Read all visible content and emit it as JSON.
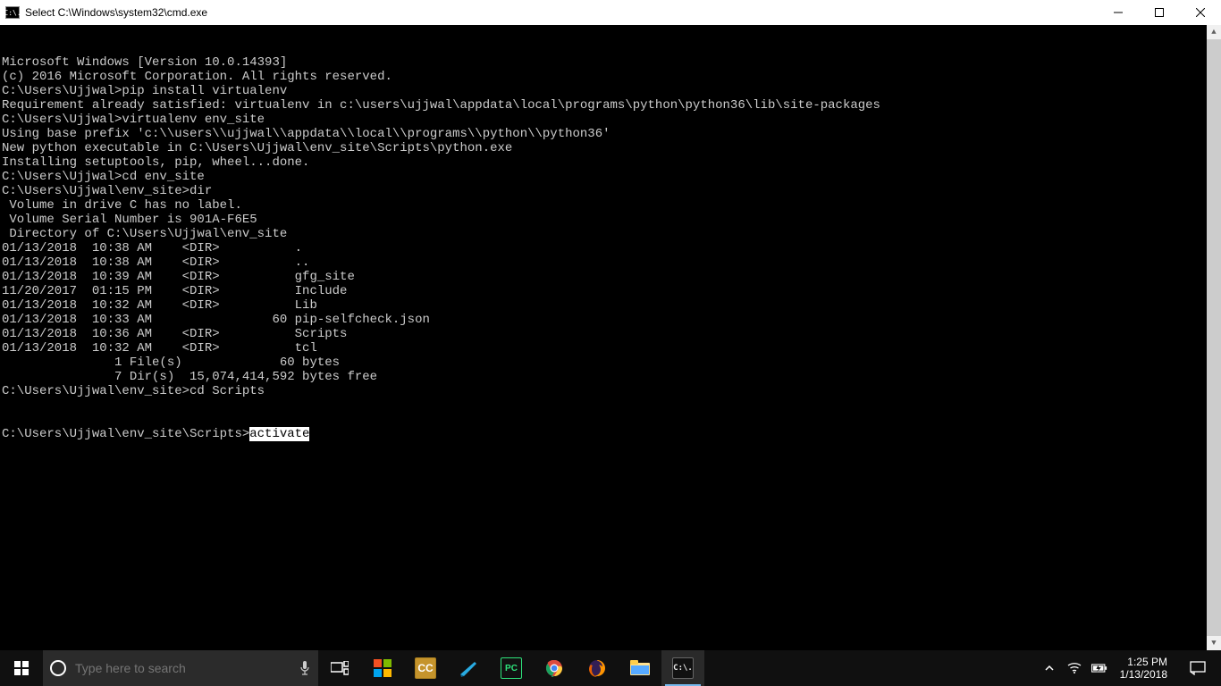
{
  "window": {
    "title": "Select C:\\Windows\\system32\\cmd.exe",
    "icon_label": "C:\\."
  },
  "console": {
    "lines": [
      "Microsoft Windows [Version 10.0.14393]",
      "(c) 2016 Microsoft Corporation. All rights reserved.",
      "",
      "C:\\Users\\Ujjwal>pip install virtualenv",
      "Requirement already satisfied: virtualenv in c:\\users\\ujjwal\\appdata\\local\\programs\\python\\python36\\lib\\site-packages",
      "",
      "C:\\Users\\Ujjwal>virtualenv env_site",
      "Using base prefix 'c:\\\\users\\\\ujjwal\\\\appdata\\\\local\\\\programs\\\\python\\\\python36'",
      "New python executable in C:\\Users\\Ujjwal\\env_site\\Scripts\\python.exe",
      "Installing setuptools, pip, wheel...done.",
      "",
      "C:\\Users\\Ujjwal>cd env_site",
      "",
      "C:\\Users\\Ujjwal\\env_site>dir",
      " Volume in drive C has no label.",
      " Volume Serial Number is 901A-F6E5",
      "",
      " Directory of C:\\Users\\Ujjwal\\env_site",
      "",
      "01/13/2018  10:38 AM    <DIR>          .",
      "01/13/2018  10:38 AM    <DIR>          ..",
      "01/13/2018  10:39 AM    <DIR>          gfg_site",
      "11/20/2017  01:15 PM    <DIR>          Include",
      "01/13/2018  10:32 AM    <DIR>          Lib",
      "01/13/2018  10:33 AM                60 pip-selfcheck.json",
      "01/13/2018  10:36 AM    <DIR>          Scripts",
      "01/13/2018  10:32 AM    <DIR>          tcl",
      "               1 File(s)             60 bytes",
      "               7 Dir(s)  15,074,414,592 bytes free",
      "",
      "C:\\Users\\Ujjwal\\env_site>cd Scripts",
      ""
    ],
    "last_prompt": "C:\\Users\\Ujjwal\\env_site\\Scripts>",
    "selected_text": "activate"
  },
  "taskbar": {
    "search_placeholder": "Type here to search",
    "time": "1:25 PM",
    "date": "1/13/2018"
  }
}
